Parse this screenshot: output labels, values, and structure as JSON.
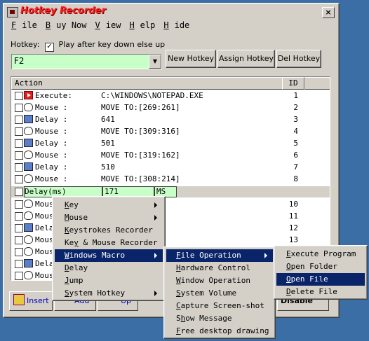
{
  "window": {
    "title": "Hotkey Recorder",
    "close_label": "×"
  },
  "menubar": [
    {
      "first": "F",
      "rest": "ile"
    },
    {
      "first": "B",
      "rest": "uy Now"
    },
    {
      "first": "V",
      "rest": "iew"
    },
    {
      "first": "H",
      "rest": "elp"
    },
    {
      "first": "H",
      "rest": "ide"
    }
  ],
  "hotkey": {
    "label": "Hotkey:",
    "play_after_label": "Play after key down else up",
    "play_after_checked": "✓",
    "value": "F2",
    "dropdown_arrow": "▼"
  },
  "buttons": {
    "new_hotkey": "New Hotkey",
    "assign_hotkey": "Assign Hotkey",
    "del_hotkey": "Del Hotkey"
  },
  "list": {
    "header_action": "Action",
    "header_id": "ID",
    "rows": [
      {
        "type": "Execute:",
        "value": "C:\\WINDOWS\\NOTEPAD.EXE",
        "id": "1",
        "icon": "execute-icon"
      },
      {
        "type": "Mouse :",
        "value": "MOVE TO:[269:261]",
        "id": "2",
        "icon": "mouse-icon"
      },
      {
        "type": "Delay :",
        "value": "641",
        "id": "3",
        "icon": "delay-icon"
      },
      {
        "type": "Mouse :",
        "value": "MOVE TO:[309:316]",
        "id": "4",
        "icon": "mouse-icon"
      },
      {
        "type": "Delay :",
        "value": "501",
        "id": "5",
        "icon": "delay-icon"
      },
      {
        "type": "Mouse :",
        "value": "MOVE TO:[319:162]",
        "id": "6",
        "icon": "mouse-icon"
      },
      {
        "type": "Delay :",
        "value": "510",
        "id": "7",
        "icon": "delay-icon"
      },
      {
        "type": "Mouse :",
        "value": "MOVE TO:[308:214]",
        "id": "8",
        "icon": "mouse-icon"
      }
    ],
    "edit_row": {
      "type": "Delay(ms)",
      "value": "171",
      "unit": "MS"
    },
    "rows_below": [
      {
        "type": "Mous",
        "id": "10",
        "icon": "mouse-icon"
      },
      {
        "type": "Mous",
        "id": "11",
        "icon": "mouse-icon"
      },
      {
        "type": "Dela",
        "id": "12",
        "icon": "delay-icon"
      },
      {
        "type": "Mous",
        "id": "13",
        "icon": "mouse-icon"
      },
      {
        "type": "Mous",
        "id": "",
        "icon": "mouse-icon"
      },
      {
        "type": "Dela",
        "id": "",
        "icon": "delay-icon"
      },
      {
        "type": "Mous",
        "id": "",
        "icon": "mouse-icon"
      }
    ]
  },
  "toolbar": {
    "insert": "Insert",
    "add": "Add",
    "up": "Up",
    "disable": "Disable"
  },
  "context_menu": [
    {
      "label": "Key",
      "u": "K",
      "submenu": true
    },
    {
      "label": "Mouse",
      "u": "M",
      "submenu": true
    },
    {
      "label": "Keystrokes Recorder",
      "u": "K",
      "submenu": false
    },
    {
      "label": "Key & Mouse Recorder",
      "u": "y",
      "submenu": false
    },
    {
      "label": "Windows Macro",
      "u": "W",
      "submenu": true,
      "selected": true
    },
    {
      "label": "Delay",
      "u": "D",
      "submenu": false
    },
    {
      "label": "Jump",
      "u": "J",
      "submenu": false
    },
    {
      "label": "System Hotkey",
      "u": "S",
      "submenu": true
    }
  ],
  "windows_macro_menu": [
    {
      "label": "File Operation",
      "u": "F",
      "submenu": true,
      "selected": true
    },
    {
      "label": "Hardware Control",
      "u": "H",
      "submenu": false
    },
    {
      "label": "Window Operation",
      "u": "W",
      "submenu": false
    },
    {
      "label": "System Volume",
      "u": "S",
      "submenu": false
    },
    {
      "label": "Capture Screen-shot",
      "u": "C",
      "submenu": false
    },
    {
      "label": "Show Message",
      "u": "h",
      "submenu": false
    },
    {
      "label": "Free desktop drawing",
      "u": "F",
      "submenu": false
    }
  ],
  "file_operation_menu": [
    {
      "label": "Execute Program",
      "u": "E",
      "selected": false
    },
    {
      "label": "Open Folder",
      "u": "O",
      "selected": false
    },
    {
      "label": "Open File",
      "u": "O",
      "selected": true
    },
    {
      "label": "Delete File",
      "u": "D",
      "selected": false
    }
  ]
}
